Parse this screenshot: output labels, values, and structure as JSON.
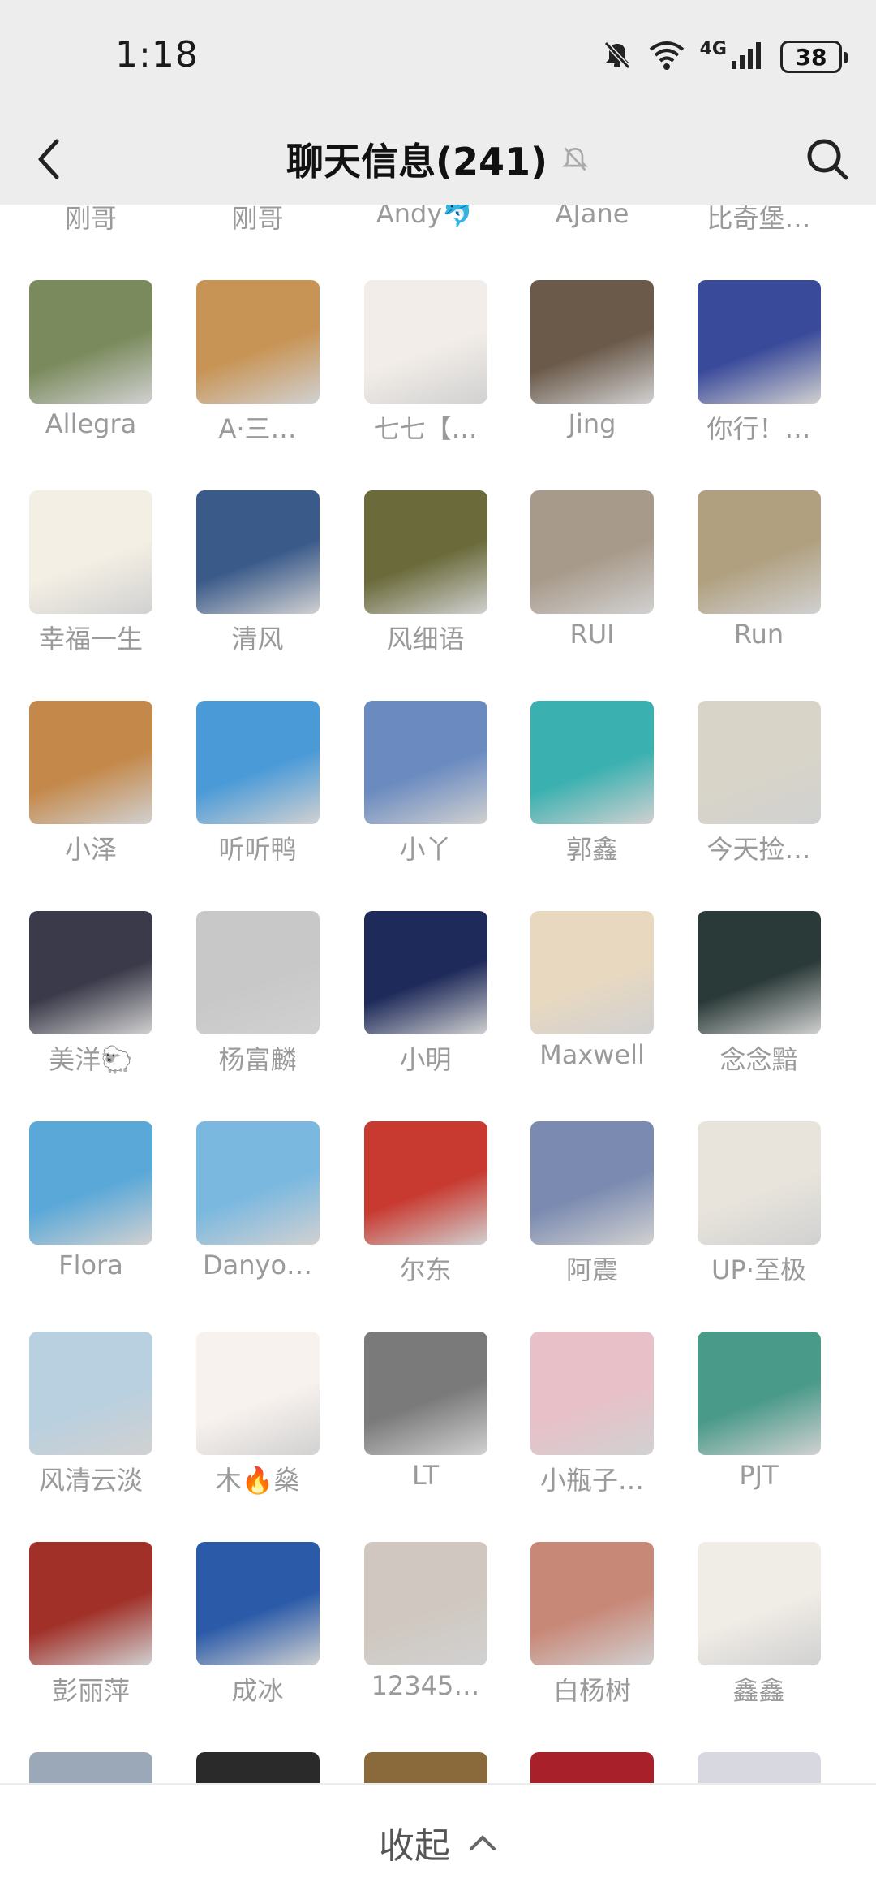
{
  "status_bar": {
    "time": "1:18",
    "network": "4G",
    "battery": "38",
    "icons": [
      "bell-muted-icon",
      "wifi-icon",
      "signal-icon",
      "battery-icon"
    ]
  },
  "header": {
    "title": "聊天信息(241)",
    "muted_icon": "bell-muted-icon",
    "back_icon": "chevron-left-icon",
    "search_icon": "search-icon"
  },
  "members": [
    {
      "name": "刚哥"
    },
    {
      "name": "刚哥"
    },
    {
      "name": "Andy🐬"
    },
    {
      "name": "AJane"
    },
    {
      "name": "比奇堡…"
    },
    {
      "name": "Allegra"
    },
    {
      "name": "A·三…"
    },
    {
      "name": "七七【…"
    },
    {
      "name": "Jing"
    },
    {
      "name": "你行！…"
    },
    {
      "name": "幸福一生"
    },
    {
      "name": "清风"
    },
    {
      "name": "风细语"
    },
    {
      "name": "RUI"
    },
    {
      "name": "Run"
    },
    {
      "name": "小泽"
    },
    {
      "name": "听听鸭"
    },
    {
      "name": "小丫"
    },
    {
      "name": "郭鑫"
    },
    {
      "name": "今天捡…"
    },
    {
      "name": "美洋🐑"
    },
    {
      "name": "杨富麟"
    },
    {
      "name": "小明"
    },
    {
      "name": "Maxwell"
    },
    {
      "name": "念念黯"
    },
    {
      "name": "Flora"
    },
    {
      "name": "Danyo…"
    },
    {
      "name": "尔东"
    },
    {
      "name": "阿震"
    },
    {
      "name": "UP·至极"
    },
    {
      "name": "风清云淡"
    },
    {
      "name": "木🔥燊"
    },
    {
      "name": "LT"
    },
    {
      "name": "小瓶子…"
    },
    {
      "name": "PJT"
    },
    {
      "name": "彭丽萍"
    },
    {
      "name": "成冰"
    },
    {
      "name": "12345…"
    },
    {
      "name": "白杨树"
    },
    {
      "name": "鑫鑫"
    }
  ],
  "avatar_colors": [
    "#7a8a5c",
    "#c89456",
    "#f2ede8",
    "#6b5a4a",
    "#3a4a9a",
    "#f4efe4",
    "#3a5a8a",
    "#6a6a3a",
    "#a89a8a",
    "#b0a080",
    "#c4884a",
    "#4a9ad8",
    "#6a8ac0",
    "#3ab0b0",
    "#d8d4c8",
    "#3a3a4a",
    "#c8c8c8",
    "#1e2a5a",
    "#e8d8c0",
    "#2a3a38",
    "#5aa8d8",
    "#7ab8e0",
    "#c83a30",
    "#7a8ab0",
    "#e8e4dc",
    "#b8d0e0",
    "#f8f2ee",
    "#7a7a7a",
    "#e8c0c8",
    "#4a9a8a",
    "#a03028",
    "#2a5aa8",
    "#d0c8c0",
    "#c88878",
    "#f0ece6"
  ],
  "partial_row_colors": [
    "#9aa8b8",
    "#2a2a2a",
    "#8a6a3a",
    "#a8202a",
    "#d8d8e0"
  ],
  "footer": {
    "collapse_label": "收起",
    "chevron_icon": "chevron-up-icon"
  }
}
